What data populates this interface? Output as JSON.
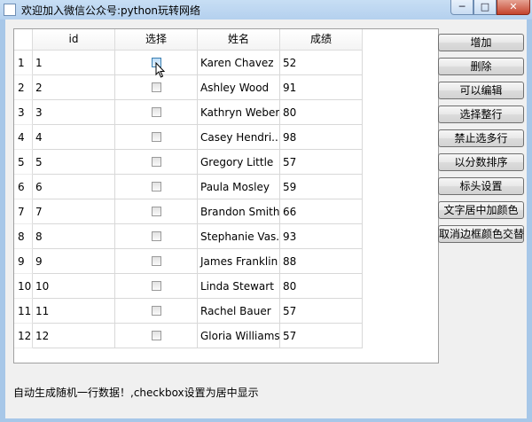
{
  "window": {
    "title": "欢迎加入微信公众号:python玩转网络",
    "min_label": "─",
    "max_label": "□",
    "close_label": "✕"
  },
  "table": {
    "headers": [
      "id",
      "选择",
      "姓名",
      "成绩"
    ],
    "rows": [
      {
        "row_no": "1",
        "id": "1",
        "checked": false,
        "name": "Karen Chavez",
        "score": "52"
      },
      {
        "row_no": "2",
        "id": "2",
        "checked": false,
        "name": "Ashley Wood",
        "score": "91"
      },
      {
        "row_no": "3",
        "id": "3",
        "checked": false,
        "name": "Kathryn Weber",
        "score": "80"
      },
      {
        "row_no": "4",
        "id": "4",
        "checked": false,
        "name": "Casey Hendri...",
        "score": "98"
      },
      {
        "row_no": "5",
        "id": "5",
        "checked": false,
        "name": "Gregory Little",
        "score": "57"
      },
      {
        "row_no": "6",
        "id": "6",
        "checked": false,
        "name": "Paula Mosley",
        "score": "59"
      },
      {
        "row_no": "7",
        "id": "7",
        "checked": false,
        "name": "Brandon Smith",
        "score": "66"
      },
      {
        "row_no": "8",
        "id": "8",
        "checked": false,
        "name": "Stephanie Vas...",
        "score": "93"
      },
      {
        "row_no": "9",
        "id": "9",
        "checked": false,
        "name": "James Franklin",
        "score": "88"
      },
      {
        "row_no": "10",
        "id": "10",
        "checked": false,
        "name": "Linda Stewart",
        "score": "80"
      },
      {
        "row_no": "11",
        "id": "11",
        "checked": false,
        "name": "Rachel Bauer",
        "score": "57"
      },
      {
        "row_no": "12",
        "id": "12",
        "checked": false,
        "name": "Gloria Williams",
        "score": "57"
      }
    ]
  },
  "buttons": [
    {
      "name": "add-button",
      "label": "增加"
    },
    {
      "name": "delete-button",
      "label": "删除"
    },
    {
      "name": "editable-button",
      "label": "可以编辑"
    },
    {
      "name": "select-row-button",
      "label": "选择整行"
    },
    {
      "name": "disable-multiselect-button",
      "label": "禁止选多行"
    },
    {
      "name": "sort-by-score-button",
      "label": "以分数排序"
    },
    {
      "name": "header-settings-button",
      "label": "标头设置"
    },
    {
      "name": "center-color-button",
      "label": "文字居中加颜色"
    },
    {
      "name": "cancel-border-alternate-button",
      "label": "取消边框颜色交替"
    }
  ],
  "status_text": "自动生成随机一行数据！,checkbox设置为居中显示",
  "colors": {
    "title_bar": "#b4d0ee",
    "close_button": "#c4432c",
    "client_bg": "#f0f0f0",
    "grid_line": "#d8d8d8"
  }
}
